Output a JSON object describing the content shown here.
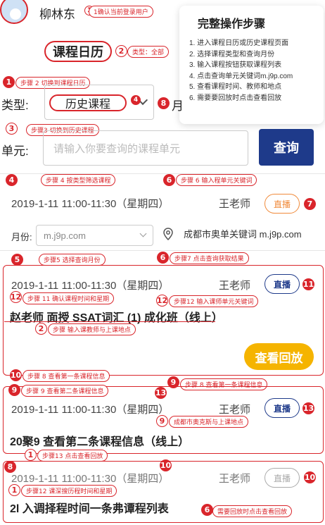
{
  "header": {
    "user_name": "柳林东",
    "page_title": "课程日历",
    "anno_confirm_user": "1确认当前登录用户",
    "anno_type": "类型：全部",
    "num_1": "1",
    "num_2": "2"
  },
  "steps_card": {
    "title": "完整操作步骤",
    "items": [
      "1. 进入课程日历或历史课程页面",
      "2. 选择课程类型和查询月份",
      "3. 输入课程按钮获取课程列表",
      "4. 点击查询单元关键词m.j9p.com",
      "5. 查看课程时间、教师和地点",
      "6. 需要要回放时点击查看回放"
    ]
  },
  "filters": {
    "type_label": "类型:",
    "type_value": "历史课程",
    "month_label_partial": "月",
    "unit_label": "单元:",
    "unit_placeholder": "请输入你要查询的课程单元",
    "query_label": "查询",
    "anno_step2": "步骤 2 切换到课程日历",
    "anno_step3": "步骤3 切换到历史课程",
    "num_1": "1",
    "num_3": "3",
    "num_4": "4",
    "num_8": "8"
  },
  "row1": {
    "anno_left": "步骤 4 按类型筛选课程",
    "anno_right": "步骤 6 输入程单元关键词",
    "num_left": "4",
    "num_right": "6",
    "time": "2019-1-11  11:00-11:30（星期四）",
    "teacher": "王老师",
    "status": "直播",
    "num_status": "7"
  },
  "month_row": {
    "label": "月份:",
    "value": "m.j9p.com",
    "location": "成都市奥单关键词 m.j9p.com"
  },
  "card1": {
    "anno_top_left": "步骤5 选择查询月份",
    "anno_top_right": "步骤7 点击查询获取结果",
    "num_top_left": "5",
    "num_top_right": "6",
    "time": "2019-1-11  11:00-11:30（星期四）",
    "teacher": "王老师",
    "status": "直播",
    "num_status": "11",
    "anno_mid_left": "步骤 11 确认课程时间和星期",
    "anno_mid_right": "步骤12 输入课师单元关键词",
    "num_mid_left": "12",
    "num_mid_right": "12",
    "title": "赵老师 面授 SSAT词汇 (1) 成化班（线上）",
    "anno_under_title": "步骤 输入课教师与上课地点",
    "num_under_title": "2",
    "replay": "查看回放",
    "anno_bottom_left": "步骤 8 查看第一条课程信息",
    "num_bottom_left": "10"
  },
  "card2": {
    "anno_top_left": "步骤 9 查看第二条课程信息",
    "anno_top_right": "步骤 8 查看第一条课程信息",
    "num_top_left": "9",
    "num_top_right": "9",
    "num_mid": "13",
    "time": "2019-1-11  11:00-11:30（星期四）",
    "teacher": "王老师",
    "status": "直播",
    "num_status": "13",
    "anno_location": "成都市奥克斯与上课地点",
    "num_location": "9",
    "title": "20聚9 查看第二条课程信息（线上）",
    "anno_bottom": "步骤13 点击查看回放",
    "num_bottom": "1"
  },
  "card3": {
    "num_left": "8",
    "num_mid": "10",
    "time": "2019-1-11  11:00-11:30（星期四）",
    "teacher": "王老师",
    "status": "直播",
    "num_status": "10",
    "anno_left": "步骤12 课深搜历程时间和星期",
    "num_anno_left": "1",
    "title": "2l 入调择程时间一条弗谭程列表",
    "anno_bottom": "需要回放时点击查看回放",
    "num_bottom": "6"
  },
  "colors": {
    "accent_red": "#d9252b",
    "navy": "#1e3a8a",
    "orange": "#f08a3a",
    "yellow": "#f5b400"
  }
}
